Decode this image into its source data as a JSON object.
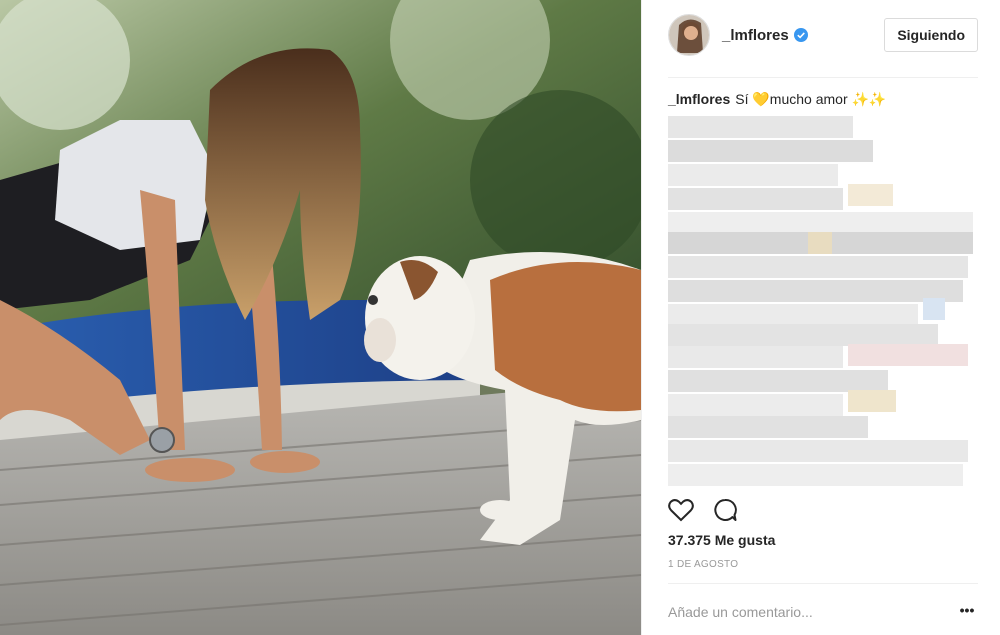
{
  "post": {
    "author": {
      "username": "_lmflores",
      "verified": true,
      "follow_label": "Siguiendo"
    },
    "caption": {
      "username": "_lmflores",
      "text": "Sí 💛mucho amor ✨✨"
    },
    "likes_text": "37.375 Me gusta",
    "date_text": "1 DE AGOSTO",
    "comment_placeholder": "Añade un comentario...",
    "more_label": "•••"
  },
  "icons": {
    "like": "heart-outline-icon",
    "comment": "comment-bubble-icon",
    "verified": "verified-badge-icon",
    "more": "more-options-icon"
  },
  "colors": {
    "verified_blue": "#3897f0",
    "text": "#262626",
    "muted": "#999999"
  }
}
